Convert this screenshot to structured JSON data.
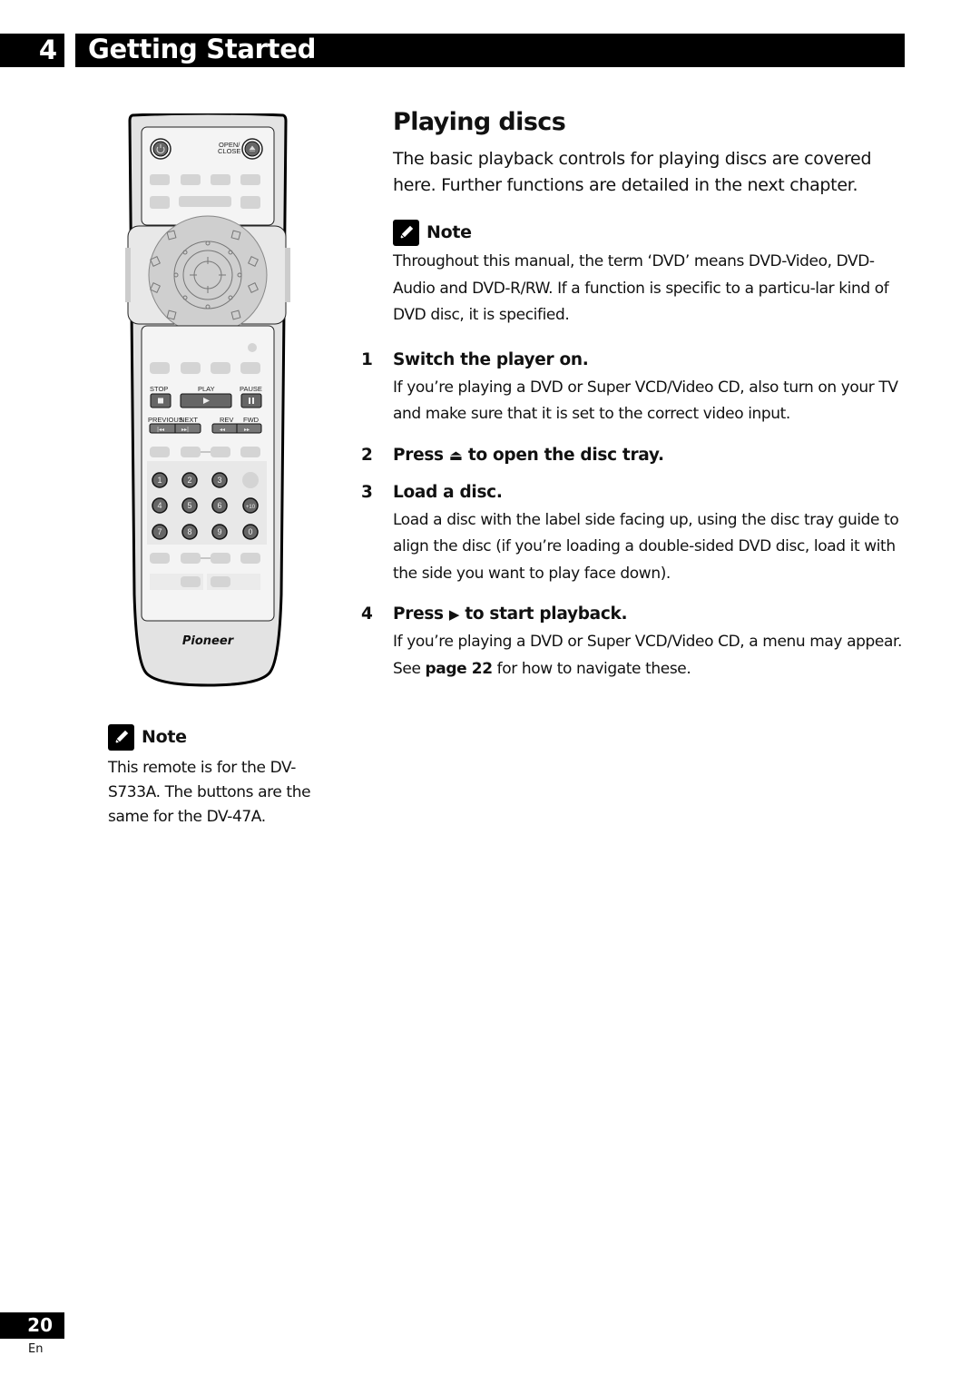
{
  "header": {
    "chapter_number": "4",
    "chapter_title": "Getting Started"
  },
  "main": {
    "title": "Playing discs",
    "lead": "The basic playback controls for playing discs are covered here. Further functions are detailed in the next chapter.",
    "note": {
      "icon": "pencil-note-icon",
      "label": "Note",
      "body": "Throughout this manual, the term ‘DVD’ means DVD-Video, DVD-Audio and DVD-R/RW. If a function is specific to a particu-lar kind of DVD disc, it is specified."
    },
    "steps": [
      {
        "number": "1",
        "title": "Switch the player on.",
        "body": "If you’re playing a DVD or Super VCD/Video CD, also turn on your TV and make sure that it is set to the correct video input."
      },
      {
        "number": "2",
        "title_before": "Press",
        "title_icon": "⏏",
        "title_after": "to open the disc tray.",
        "body": ""
      },
      {
        "number": "3",
        "title": "Load a disc.",
        "body": "Load a disc with the label side facing up, using the disc tray guide to align the disc (if you’re loading a double-sided DVD disc, load it with the side you want to play face down)."
      },
      {
        "number": "4",
        "title_before": "Press",
        "title_icon": "▶",
        "title_after": "to start playback.",
        "body_before": "If you’re playing a DVD or Super VCD/Video CD, a menu may appear. See",
        "body_link": "page 22",
        "body_after": "for how to navigate these."
      }
    ]
  },
  "remote": {
    "brand": "Pioneer",
    "labels": {
      "open_close": "OPEN/\nCLOSE",
      "stop": "STOP",
      "play": "PLAY",
      "pause": "PAUSE",
      "previous": "PREVIOUS",
      "next": "NEXT",
      "rev": "REV",
      "fwd": "FWD"
    },
    "number_keys": [
      "1",
      "2",
      "3",
      "",
      "4",
      "5",
      "6",
      "+10",
      "7",
      "8",
      "9",
      "0"
    ]
  },
  "side_note": {
    "label": "Note",
    "body": "This remote is for the DV-S733A. The buttons are the same for the DV-47A."
  },
  "footer": {
    "page_number": "20",
    "language": "En"
  }
}
